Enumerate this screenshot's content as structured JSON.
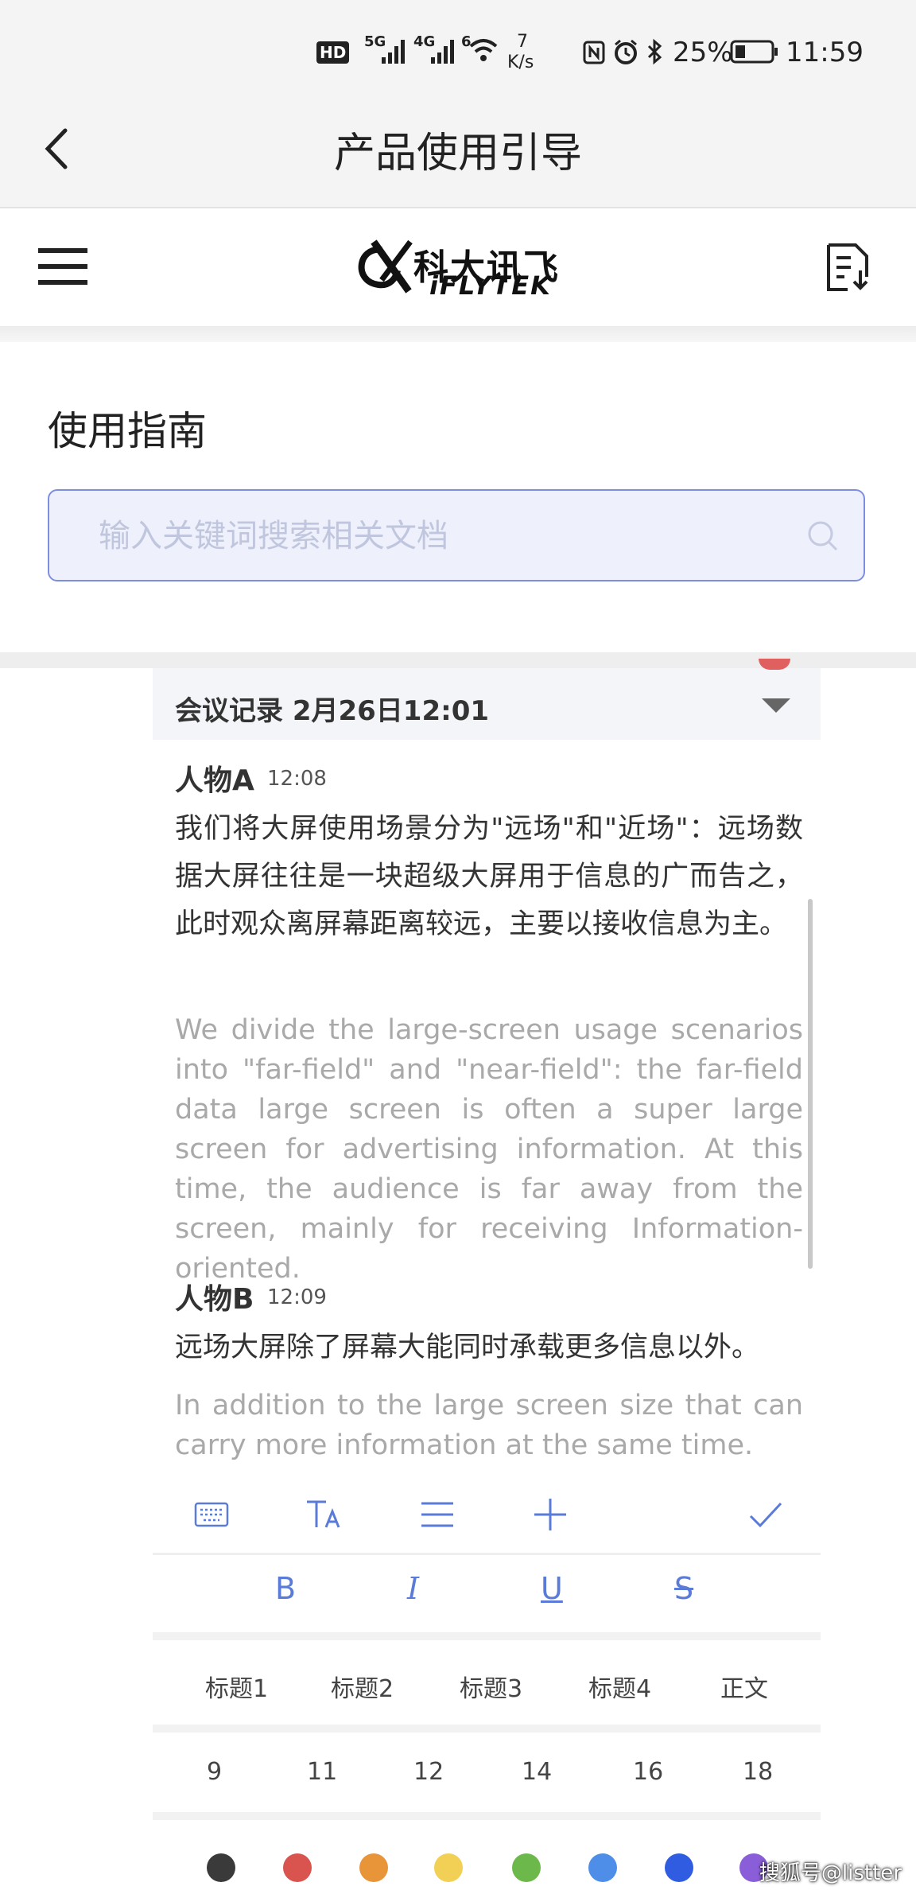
{
  "status_bar": {
    "hd_badge": "HD",
    "network_1": "5G",
    "network_2": "4G",
    "wifi_gen": "6",
    "speed_value": "7",
    "speed_unit": "K/s",
    "battery_percent": "25%",
    "time": "11:59"
  },
  "header": {
    "title": "产品使用引导"
  },
  "app": {
    "logo_cn": "科大讯飞",
    "logo_en": "iFLYTEK"
  },
  "guide": {
    "title": "使用指南",
    "search_placeholder": "输入关键词搜索相关文档"
  },
  "meeting": {
    "title": "会议记录 2月26日12:01",
    "entries": [
      {
        "speaker": "人物A",
        "time": "12:08",
        "text_cn": "我们将大屏使用场景分为\"远场\"和\"近场\"：远场数据大屏往往是一块超级大屏用于信息的广而告之，此时观众离屏幕距离较远，主要以接收信息为主。",
        "text_en": "We divide the large-screen usage scenarios into \"far-field\" and \"near-field\": the far-field data large screen is often a super large screen for advertising information. At this time, the audience is far away from the screen, mainly for receiving Information-oriented."
      },
      {
        "speaker": "人物B",
        "time": "12:09",
        "text_cn": "远场大屏除了屏幕大能同时承载更多信息以外。",
        "text_en": "In addition to the large screen size that can carry more information at the same time."
      }
    ]
  },
  "toolbar": {
    "icons": [
      "keyboard-icon",
      "text-size-icon",
      "list-icon",
      "plus-icon",
      "check-icon"
    ],
    "format": {
      "bold": "B",
      "italic": "I",
      "underline": "U",
      "strike": "S"
    },
    "headings": [
      "标题1",
      "标题2",
      "标题3",
      "标题4",
      "正文"
    ],
    "font_sizes": [
      "9",
      "11",
      "12",
      "14",
      "16",
      "18"
    ],
    "colors": [
      "#3a3a3a",
      "#d9534f",
      "#e8953a",
      "#f2cf55",
      "#6cb84a",
      "#4f8ee8",
      "#2f5ce0",
      "#8a5ed8"
    ]
  },
  "watermark": "搜狐号@listter"
}
